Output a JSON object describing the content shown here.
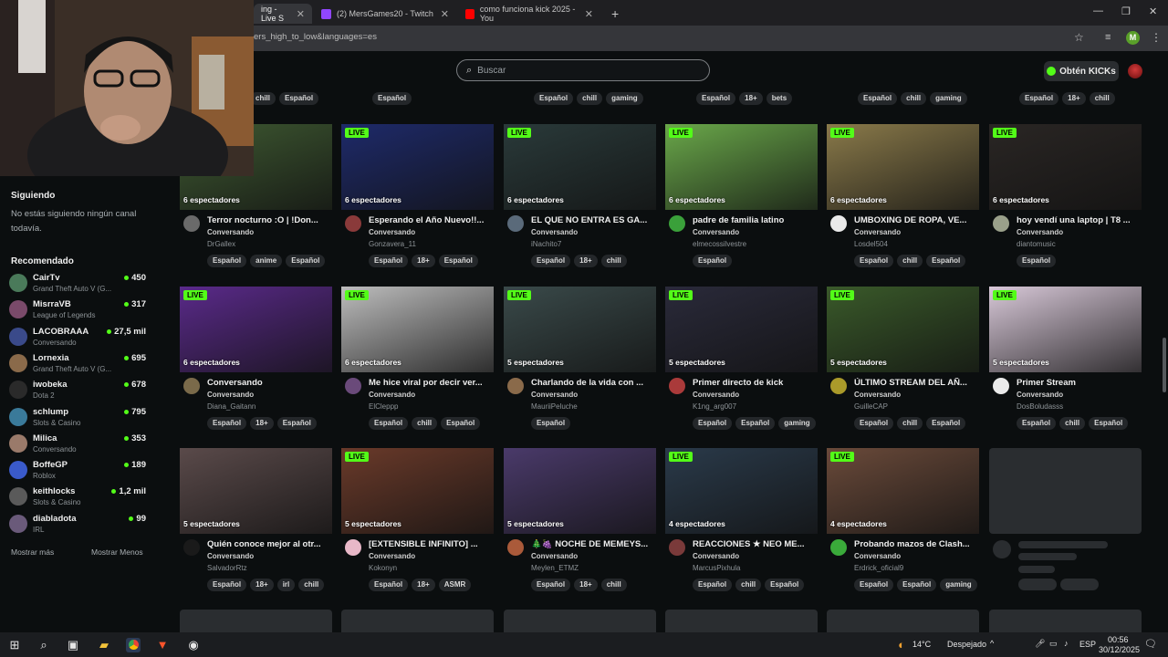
{
  "browser": {
    "tabs": [
      {
        "label": "ing - Live S",
        "active": true,
        "favicon_color": "#53fc18"
      },
      {
        "label": "(2) MersGames20 - Twitch",
        "active": false,
        "favicon_color": "#9146ff"
      },
      {
        "label": "como funciona kick 2025 - You",
        "active": false,
        "favicon_color": "#ff0000"
      }
    ],
    "new_tab": "+",
    "url": "ers_high_to_low&languages=es",
    "profile_initial": "M"
  },
  "header": {
    "search_placeholder": "Buscar",
    "get_kicks": "Obtén KICKs"
  },
  "top_row_tags": [
    [
      "chill",
      "Español"
    ],
    [
      "Español"
    ],
    [
      "Español",
      "chill",
      "gaming"
    ],
    [
      "Español",
      "18+",
      "bets"
    ],
    [
      "Español",
      "chill",
      "gaming"
    ],
    [
      "Español",
      "18+",
      "chill"
    ]
  ],
  "sidebar": {
    "following_title": "Siguiendo",
    "following_empty": "No estás siguiendo ningún canal todavía.",
    "recommended_title": "Recomendado",
    "recommended": [
      {
        "name": "CairTv",
        "game": "Grand Theft Auto V (G...",
        "viewers": "450",
        "color": "#4a7a5a"
      },
      {
        "name": "MisrraVB",
        "game": "League of Legends",
        "viewers": "317",
        "color": "#7a4a6a"
      },
      {
        "name": "LACOBRAAA",
        "game": "Conversando",
        "viewers": "27,5 mil",
        "color": "#3a4a8a"
      },
      {
        "name": "Lornexia",
        "game": "Grand Theft Auto V (G...",
        "viewers": "695",
        "color": "#8a6a4a"
      },
      {
        "name": "iwobeka",
        "game": "Dota 2",
        "viewers": "678",
        "color": "#2a2a2a"
      },
      {
        "name": "schlump",
        "game": "Slots & Casino",
        "viewers": "795",
        "color": "#3a7a9a"
      },
      {
        "name": "Milica",
        "game": "Conversando",
        "viewers": "353",
        "color": "#9a7a6a"
      },
      {
        "name": "BoffeGP",
        "game": "Roblox",
        "viewers": "189",
        "color": "#3a5aca"
      },
      {
        "name": "keithlocks",
        "game": "Slots & Casino",
        "viewers": "1,2 mil",
        "color": "#5a5a5a"
      },
      {
        "name": "diabladota",
        "game": "IRL",
        "viewers": "99",
        "color": "#6a5a7a"
      }
    ],
    "show_more": "Mostrar más",
    "show_less": "Mostrar Menos"
  },
  "streams": [
    {
      "title": "Terror nocturno :O | !Don...",
      "category": "Conversando",
      "user": "DrGallex",
      "viewers": "6 espectadores",
      "tags": [
        "Español",
        "anime",
        "Español"
      ],
      "thumb": "#3f5a32",
      "avatar": "#6a6a6a",
      "live": false
    },
    {
      "title": "Esperando el Año Nuevo!!...",
      "category": "Conversando",
      "user": "Gonzavera_11",
      "viewers": "6 espectadores",
      "tags": [
        "Español",
        "18+",
        "Español"
      ],
      "thumb": "#1e2a6a",
      "avatar": "#8a3a3a",
      "live": true
    },
    {
      "title": "EL QUE NO ENTRA ES GA...",
      "category": "Conversando",
      "user": "iNachito7",
      "viewers": "6 espectadores",
      "tags": [
        "Español",
        "18+",
        "chill"
      ],
      "thumb": "#2a3a3a",
      "avatar": "#5a6a7a",
      "live": true
    },
    {
      "title": "padre de familia latino",
      "category": "Conversando",
      "user": "elmecossilvestre",
      "viewers": "6 espectadores",
      "tags": [
        "Español"
      ],
      "thumb": "#6aa84a",
      "avatar": "#3aa03a",
      "live": true
    },
    {
      "title": "UMBOXING DE ROPA, VE...",
      "category": "Conversando",
      "user": "Losdel504",
      "viewers": "6 espectadores",
      "tags": [
        "Español",
        "chill",
        "Español"
      ],
      "thumb": "#8a7a4a",
      "avatar": "#eaeaea",
      "live": true
    },
    {
      "title": "hoy vendí una laptop | T8 ...",
      "category": "Conversando",
      "user": "diantomusic",
      "viewers": "6 espectadores",
      "tags": [
        "Español"
      ],
      "thumb": "#2a2624",
      "avatar": "#9aa08a",
      "live": true
    },
    {
      "title": "Conversando",
      "category": "Conversando",
      "user": "Diana_Gaitann",
      "viewers": "6 espectadores",
      "tags": [
        "Español",
        "18+",
        "Español"
      ],
      "thumb": "#5a2a8a",
      "avatar": "#7a6a4a",
      "live": true
    },
    {
      "title": "Me hice viral por decir ver...",
      "category": "Conversando",
      "user": "ElCleppp",
      "viewers": "6 espectadores",
      "tags": [
        "Español",
        "chill",
        "Español"
      ],
      "thumb": "#bdbdbd",
      "avatar": "#6a4a7a",
      "live": true
    },
    {
      "title": "Charlando de la vida con ...",
      "category": "Conversando",
      "user": "MauriiPeluche",
      "viewers": "5 espectadores",
      "tags": [
        "Español"
      ],
      "thumb": "#3a4a4a",
      "avatar": "#8a6a4a",
      "live": true
    },
    {
      "title": "Primer directo de kick",
      "category": "Conversando",
      "user": "K1ng_arg007",
      "viewers": "5 espectadores",
      "tags": [
        "Español",
        "Español",
        "gaming"
      ],
      "thumb": "#2a2a3a",
      "avatar": "#aa3a3a",
      "live": true
    },
    {
      "title": "ÚLTIMO STREAM DEL AÑ...",
      "category": "Conversando",
      "user": "GuilleCAP",
      "viewers": "5 espectadores",
      "tags": [
        "Español",
        "chill",
        "Español"
      ],
      "thumb": "#3a5a2a",
      "avatar": "#aa9a2a",
      "live": true
    },
    {
      "title": "Primer Stream",
      "category": "Conversando",
      "user": "DosBoludasss",
      "viewers": "5 espectadores",
      "tags": [
        "Español",
        "chill",
        "Español"
      ],
      "thumb": "#d8c8d8",
      "avatar": "#eaeaea",
      "live": true
    },
    {
      "title": "Quién conoce mejor al otr...",
      "category": "Conversando",
      "user": "SalvadorRtz",
      "viewers": "5 espectadores",
      "tags": [
        "Español",
        "18+",
        "irl",
        "chill"
      ],
      "thumb": "#5a4a4a",
      "avatar": "#1a1a1a",
      "live": false
    },
    {
      "title": "[EXTENSIBLE INFINITO] ...",
      "category": "Conversando",
      "user": "Kokonyn",
      "viewers": "5 espectadores",
      "tags": [
        "Español",
        "18+",
        "ASMR"
      ],
      "thumb": "#6a3a2a",
      "avatar": "#e8b8c8",
      "live": true
    },
    {
      "title": "🎄🍇 NOCHE DE MEMEYS...",
      "category": "Conversando",
      "user": "Meylen_ETMZ",
      "viewers": "5 espectadores",
      "tags": [
        "Español",
        "18+",
        "chill"
      ],
      "thumb": "#4a3a6a",
      "avatar": "#aa5a3a",
      "live": false
    },
    {
      "title": "REACCIONES ★ NEO ME...",
      "category": "Conversando",
      "user": "MarcusPixhula",
      "viewers": "4 espectadores",
      "tags": [
        "Español",
        "chill",
        "Español"
      ],
      "thumb": "#2a3a4a",
      "avatar": "#7a3a3a",
      "live": true
    },
    {
      "title": "Probando mazos de Clash...",
      "category": "Conversando",
      "user": "Erdrick_oficial9",
      "viewers": "4 espectadores",
      "tags": [
        "Español",
        "Español",
        "gaming"
      ],
      "thumb": "#6a4a3a",
      "avatar": "#3aaa3a",
      "live": true
    }
  ],
  "taskbar": {
    "temperature": "14°C",
    "weather": "Despejado",
    "language": "ESP",
    "time": "00:56",
    "date": "30/12/2025"
  }
}
